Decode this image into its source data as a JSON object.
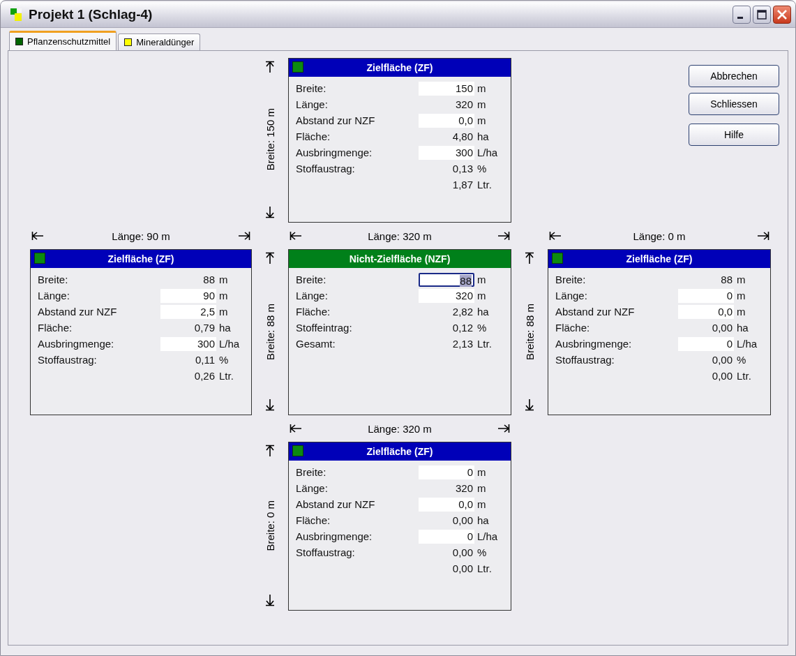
{
  "window": {
    "title": "Projekt 1 (Schlag-4)"
  },
  "tabs": [
    {
      "label": "Pflanzenschutzmittel",
      "color": "#006400",
      "selected": true
    },
    {
      "label": "Mineraldünger",
      "color": "#ffff00",
      "selected": false
    }
  ],
  "buttons": [
    "Abbrechen",
    "Schliessen",
    "Hilfe"
  ],
  "diagram": {
    "top": {
      "breite": "Breite: 150 m",
      "panel": {
        "kind": "zf",
        "title": "Zielfläche (ZF)",
        "rows": [
          {
            "label": "Breite:",
            "value": "150",
            "unit": "m",
            "kind": "input",
            "focused": false
          },
          {
            "label": "Länge:",
            "value": "320",
            "unit": "m",
            "kind": "text"
          },
          {
            "label": "Abstand zur NZF",
            "value": "0,0",
            "unit": "m",
            "kind": "input",
            "focused": false
          },
          {
            "label": "Fläche:",
            "value": "4,80",
            "unit": "ha",
            "kind": "text"
          },
          {
            "label": "Ausbringmenge:",
            "value": "300",
            "unit": "L/ha",
            "kind": "input",
            "focused": false
          },
          {
            "label": "Stoffaustrag:",
            "value": "0,13",
            "unit": "%",
            "kind": "text"
          },
          {
            "value": "1,87",
            "unit": "Ltr.",
            "kind": "text"
          }
        ]
      }
    },
    "left": {
      "laenge": "Länge: 90 m",
      "panel": {
        "kind": "zf",
        "title": "Zielfläche (ZF)",
        "rows": [
          {
            "label": "Breite:",
            "value": "88",
            "unit": "m",
            "kind": "text"
          },
          {
            "label": "Länge:",
            "value": "90",
            "unit": "m",
            "kind": "input",
            "focused": false
          },
          {
            "label": "Abstand zur NZF",
            "value": "2,5",
            "unit": "m",
            "kind": "input",
            "focused": false
          },
          {
            "label": "Fläche:",
            "value": "0,79",
            "unit": "ha",
            "kind": "text"
          },
          {
            "label": "Ausbringmenge:",
            "value": "300",
            "unit": "L/ha",
            "kind": "input",
            "focused": false
          },
          {
            "label": "Stoffaustrag:",
            "value": "0,11",
            "unit": "%",
            "kind": "text"
          },
          {
            "value": "0,26",
            "unit": "Ltr.",
            "kind": "text"
          }
        ]
      }
    },
    "center": {
      "laenge": "Länge: 320 m",
      "breite": "Breite: 88 m",
      "panel": {
        "kind": "nzf",
        "title": "Nicht-Zielfläche (NZF)",
        "rows": [
          {
            "label": "Breite:",
            "value": "88",
            "unit": "m",
            "kind": "input",
            "focused": true
          },
          {
            "label": "Länge:",
            "value": "320",
            "unit": "m",
            "kind": "input",
            "focused": false
          },
          {
            "label": "Fläche:",
            "value": "2,82",
            "unit": "ha",
            "kind": "text"
          },
          {
            "label": "Stoffeintrag:",
            "value": "0,12",
            "unit": "%",
            "kind": "text"
          },
          {
            "label": "Gesamt:",
            "value": "2,13",
            "unit": "Ltr.",
            "kind": "text"
          }
        ]
      }
    },
    "right": {
      "laenge": "Länge: 0 m",
      "breite": "Breite: 88 m",
      "panel": {
        "kind": "zf",
        "title": "Zielfläche (ZF)",
        "rows": [
          {
            "label": "Breite:",
            "value": "88",
            "unit": "m",
            "kind": "text"
          },
          {
            "label": "Länge:",
            "value": "0",
            "unit": "m",
            "kind": "input",
            "focused": false
          },
          {
            "label": "Abstand zur NZF",
            "value": "0,0",
            "unit": "m",
            "kind": "input",
            "focused": false
          },
          {
            "label": "Fläche:",
            "value": "0,00",
            "unit": "ha",
            "kind": "text"
          },
          {
            "label": "Ausbringmenge:",
            "value": "0",
            "unit": "L/ha",
            "kind": "input",
            "focused": false
          },
          {
            "label": "Stoffaustrag:",
            "value": "0,00",
            "unit": "%",
            "kind": "text"
          },
          {
            "value": "0,00",
            "unit": "Ltr.",
            "kind": "text"
          }
        ]
      }
    },
    "bottom": {
      "laenge": "Länge: 320 m",
      "breite": "Breite: 0 m",
      "panel": {
        "kind": "zf",
        "title": "Zielfläche (ZF)",
        "rows": [
          {
            "label": "Breite:",
            "value": "0",
            "unit": "m",
            "kind": "input",
            "focused": false
          },
          {
            "label": "Länge:",
            "value": "320",
            "unit": "m",
            "kind": "text"
          },
          {
            "label": "Abstand zur NZF",
            "value": "0,0",
            "unit": "m",
            "kind": "input",
            "focused": false
          },
          {
            "label": "Fläche:",
            "value": "0,00",
            "unit": "ha",
            "kind": "text"
          },
          {
            "label": "Ausbringmenge:",
            "value": "0",
            "unit": "L/ha",
            "kind": "input",
            "focused": false
          },
          {
            "label": "Stoffaustrag:",
            "value": "0,00",
            "unit": "%",
            "kind": "text"
          },
          {
            "value": "0,00",
            "unit": "Ltr.",
            "kind": "text"
          }
        ]
      }
    }
  }
}
